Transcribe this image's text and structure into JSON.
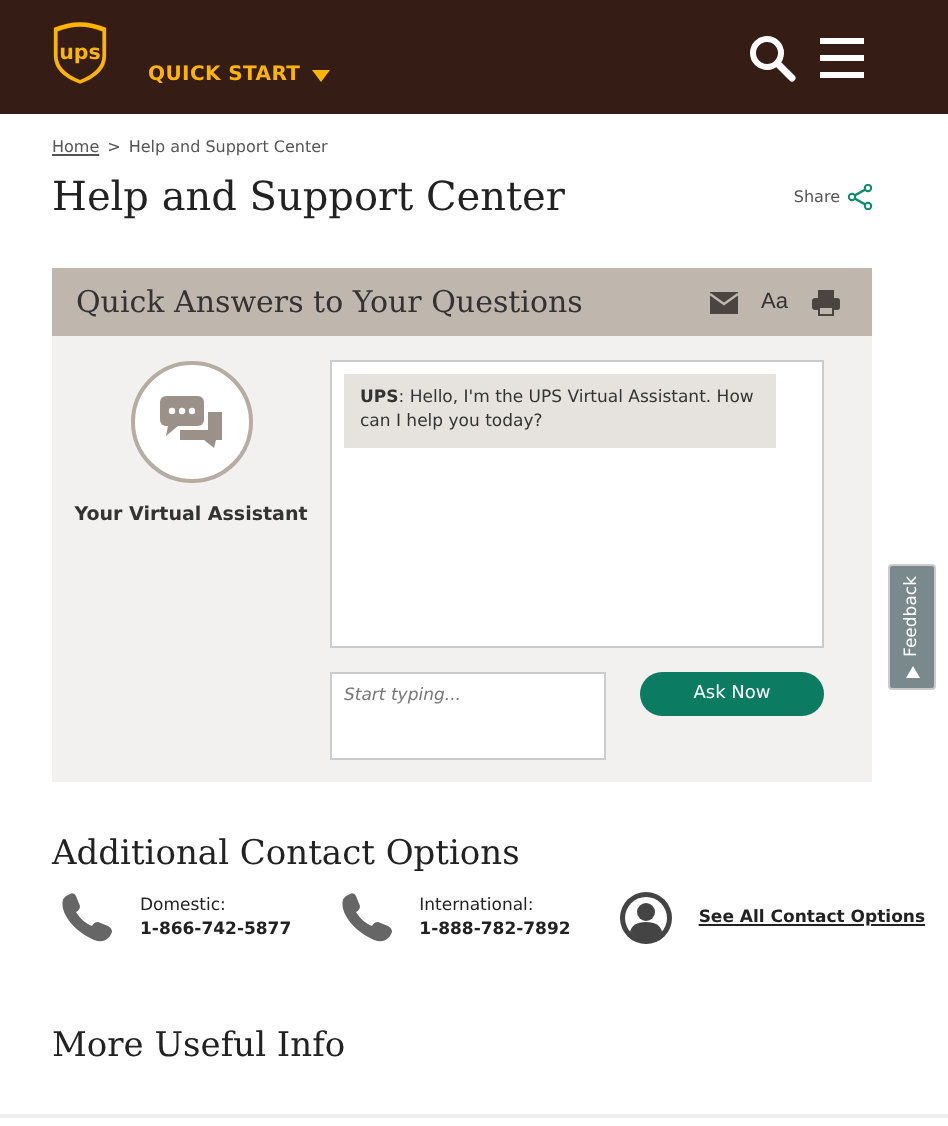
{
  "header": {
    "logo_text": "ups",
    "quick_start": "QUICK START"
  },
  "breadcrumb_separator": ">",
  "breadcrumb": [
    {
      "label": "Home",
      "link": true
    },
    {
      "label": "Help and Support Center",
      "link": false
    }
  ],
  "page_title": "Help and Support Center",
  "share": "Share",
  "panel": {
    "title": "Quick Answers to Your Questions",
    "font_button": "Aa",
    "assistant_label": "Your Virtual Assistant",
    "messages": [
      "**UPS**: Hello, I'm the UPS Virtual Assistant. How can I help you today?"
    ],
    "input": {
      "placeholder": "Start typing..."
    },
    "ask_button": "Ask Now"
  },
  "feedback": "Feedback",
  "contact": {
    "title": "Additional Contact Options",
    "options": [
      {
        "kind": "phone",
        "label": "Domestic:",
        "number": "1-866-742-5877"
      },
      {
        "kind": "phone",
        "label": "International:",
        "number": "1-888-782-7892"
      },
      {
        "kind": "link",
        "label": "See All Contact Options"
      }
    ]
  },
  "more_title": "More Useful Info"
}
